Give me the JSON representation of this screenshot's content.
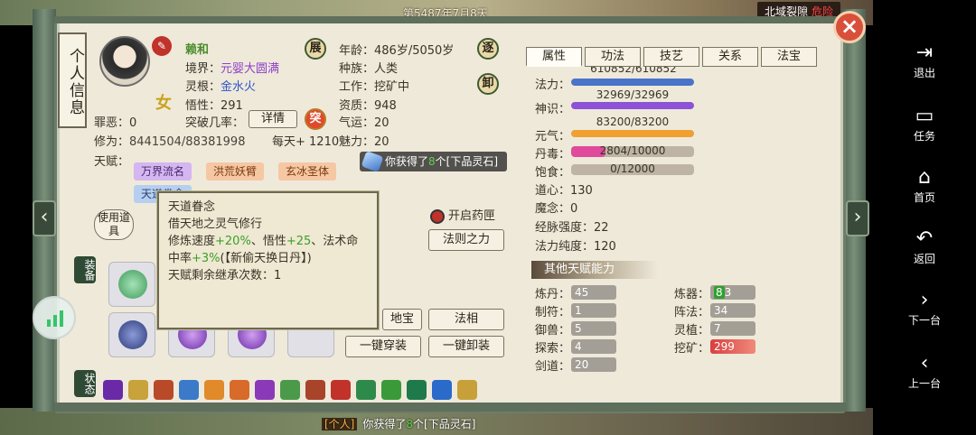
{
  "top": {
    "date": "第5487年7月8天",
    "area": "北域裂隙",
    "area_tag": "危险"
  },
  "title": "个人信息",
  "profile": {
    "name": "赖和",
    "gender": "女",
    "realm_label": "境界：",
    "realm": "元婴大圆满",
    "root_label": "灵根：",
    "root": "金水火",
    "insight_label": "悟性：",
    "insight": "291",
    "breakthrough_label": "突破几率：",
    "sin_label": "罪恶：",
    "sin": "0",
    "cultivation_label": "修为：",
    "cultivation": "8441504/88381998",
    "daily": "每天+ 1210",
    "age_label": "年龄：",
    "age": "486岁/5050岁",
    "race_label": "种族：",
    "race": "人类",
    "work_label": "工作：",
    "work": "挖矿中",
    "aptitude_label": "资质：",
    "aptitude": "948",
    "luck_label": "气运：",
    "luck": "20",
    "charm_label": "魅力：",
    "charm": "20"
  },
  "buttons": {
    "expand": "展",
    "escape": "逐",
    "unload": "卸",
    "breakthrough": "突",
    "detail": "详情",
    "use_item": "使用道具",
    "open_pill": "开启药匣",
    "law_power": "法则之力",
    "earth_treasure": "地宝",
    "law_form": "法相",
    "equip_all": "一键穿装",
    "unequip_all": "一键卸装"
  },
  "talents": {
    "label": "天赋：",
    "items": [
      "万界流名",
      "洪荒妖臂",
      "玄冰圣体",
      "天道眷念"
    ]
  },
  "tooltip": {
    "title": "天道眷念",
    "line1": "借天地之灵气修行",
    "line2_a": "修炼速度",
    "line2_b": "+20%",
    "line2_c": "、悟性",
    "line2_d": "+25",
    "line2_e": "、法术命",
    "line3_a": "中率",
    "line3_b": "+3%",
    "line3_c": "(【新偷天换日丹】)",
    "line4": "天赋剩余继承次数：1"
  },
  "notify": {
    "pre": "你获得了",
    "num": "8",
    "post": "个[下品灵石]"
  },
  "side_tags": {
    "equip": "装备",
    "status": "状态"
  },
  "tabs": [
    "属性",
    "功法",
    "技艺",
    "关系",
    "法宝"
  ],
  "stats": {
    "top_partial": "610852/610852",
    "mana_label": "法力：",
    "sense_label": "神识：",
    "sense": "32969/32969",
    "vital_label": "元气：",
    "vital": "83200/83200",
    "poison_label": "丹毒：",
    "poison": "2804/10000",
    "food_label": "饱食：",
    "food": "0/12000",
    "dao_label": "道心：",
    "dao": "130",
    "demon_label": "魔念：",
    "demon": "0",
    "meridian_label": "经脉强度：",
    "meridian": "22",
    "purity_label": "法力纯度：",
    "purity": "120"
  },
  "other_header": "其他天赋能力",
  "skills": {
    "alchemy_label": "炼丹：",
    "alchemy": "45",
    "talisman_label": "制符：",
    "talisman": "1",
    "beast_label": "御兽：",
    "beast": "5",
    "explore_label": "探索：",
    "explore": "4",
    "sword_label": "剑道：",
    "sword": "20",
    "forge_label": "炼器：",
    "forge_hl": "8",
    "forge_rest": "3",
    "array_label": "阵法：",
    "array": "34",
    "plant_label": "灵植：",
    "plant": "7",
    "mining_label": "挖矿：",
    "mining": "299"
  },
  "bottom_msg": {
    "src": "[个人]",
    "pre": "你获得了",
    "num": "8",
    "post": "个[下品灵石]"
  },
  "android_nav": [
    {
      "icon": "logout-icon",
      "label": "退出"
    },
    {
      "icon": "task-icon",
      "label": "任务"
    },
    {
      "icon": "home-icon",
      "label": "首页"
    },
    {
      "icon": "back-icon",
      "label": "返回"
    },
    {
      "icon": "next-icon",
      "label": "下一台"
    },
    {
      "icon": "prev-icon",
      "label": "上一台"
    }
  ],
  "colors": {
    "mana": "#4a74c8",
    "sense": "#8e52d8",
    "vital": "#f0a030",
    "poison": "#e04a9a",
    "panel": "#efe9da",
    "frame": "#6e7d6a"
  },
  "bars": {
    "mana": 1.0,
    "sense": 1.0,
    "vital": 1.0,
    "poison": 0.28,
    "food": 0.0
  }
}
